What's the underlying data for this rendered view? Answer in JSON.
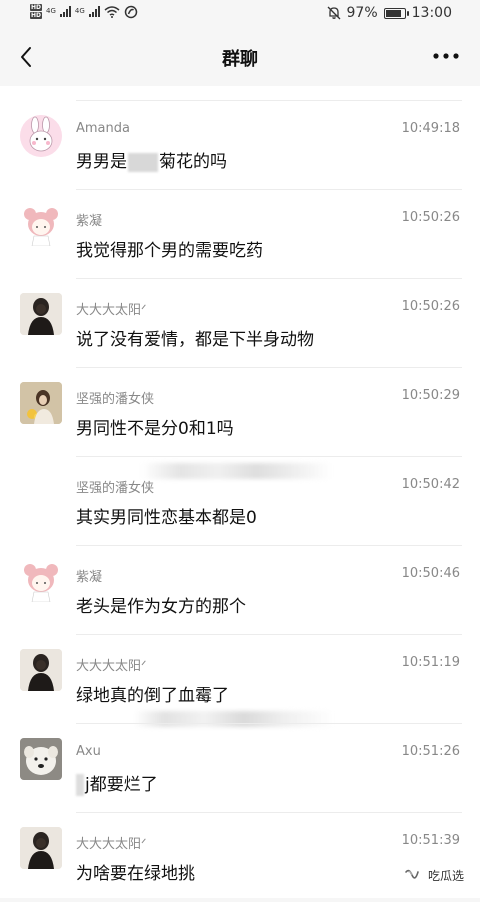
{
  "status_bar": {
    "hd1": "HD",
    "hd2": "HD",
    "net1": "4G",
    "net2": "4G",
    "battery_percent": "97%",
    "battery_level": 0.97,
    "time": "13:00",
    "icons": [
      "hd-icon",
      "signal-icon",
      "wifi-icon",
      "nfc-icon",
      "mute-icon",
      "battery-icon"
    ]
  },
  "header": {
    "title": "群聊",
    "back_icon": "chevron-left-icon",
    "more_icon": "more-dots-icon"
  },
  "messages": [
    {
      "sender": "Amanda",
      "time": "10:49:18",
      "pre": "男男是",
      "post": "菊花的吗",
      "avatar": "bunny"
    },
    {
      "sender": "紫凝",
      "time": "10:50:26",
      "text": "我觉得那个男的需要吃药",
      "avatar": "girl-pink"
    },
    {
      "sender": "大大大太阳ᐟ",
      "time": "10:50:26",
      "text": "说了没有爱情，都是下半身动物",
      "avatar": "dark-girl"
    },
    {
      "sender": "坚强的潘女侠",
      "time": "10:50:29",
      "text": "男同性不是分0和1吗",
      "avatar": "yellow-girl"
    },
    {
      "sender": "坚强的潘女侠",
      "time": "10:50:42",
      "text": "其实男同性恋基本都是0",
      "avatar": "none"
    },
    {
      "sender": "紫凝",
      "time": "10:50:46",
      "text": "老头是作为女方的那个",
      "avatar": "girl-pink"
    },
    {
      "sender": "大大大太阳ᐟ",
      "time": "10:51:19",
      "text": "绿地真的倒了血霉了",
      "avatar": "dark-girl"
    },
    {
      "sender": "Axu",
      "time": "10:51:26",
      "text": "j都要烂了",
      "avatar": "dog"
    },
    {
      "sender": "大大大太阳ᐟ",
      "time": "10:51:39",
      "text": "为啥要在绿地挑",
      "avatar": "dark-girl"
    }
  ],
  "watermark": {
    "text": "吃瓜选",
    "icon": "wechat-channel-icon"
  }
}
